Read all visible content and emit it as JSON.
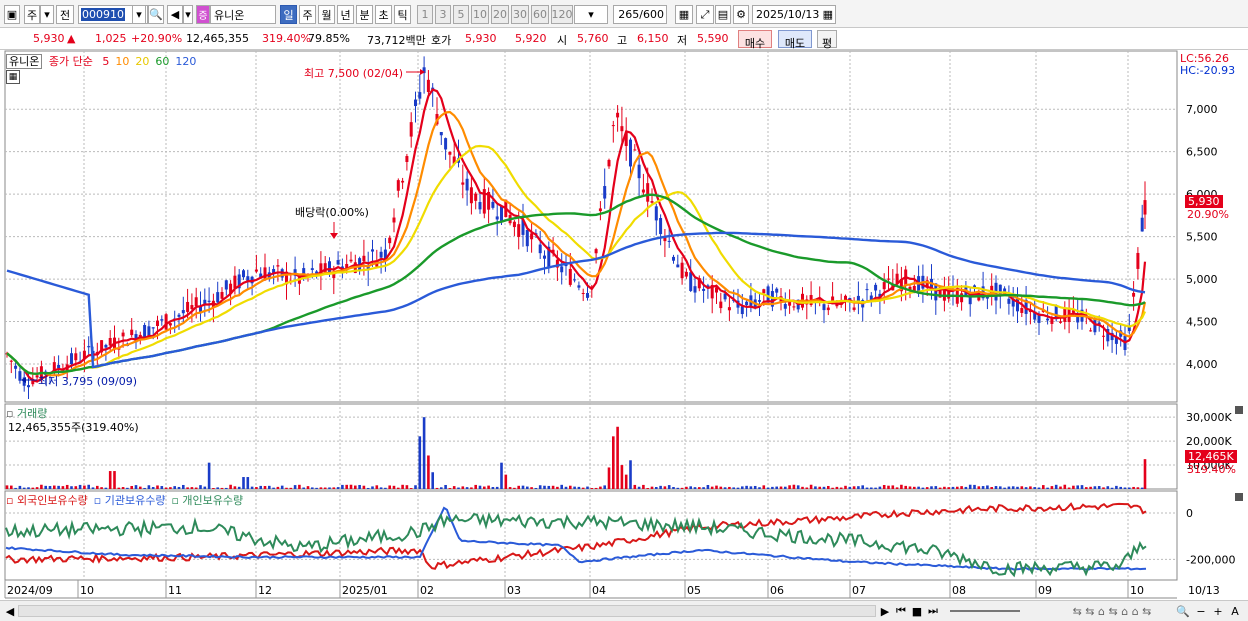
{
  "toolbar": {
    "mode_label": "주",
    "prev_label": "전",
    "stock_code": "000910",
    "stock_name": "유니온",
    "badge_text": "증",
    "periods": [
      "일",
      "주",
      "월",
      "년",
      "분",
      "초",
      "틱"
    ],
    "active_period": "일",
    "intervals": [
      "1",
      "3",
      "5",
      "10",
      "20",
      "30",
      "60",
      "120"
    ],
    "count_value": "265",
    "count_total": "/600",
    "date": "2025/10/13"
  },
  "quote": {
    "price": "5,930",
    "change": "1,025",
    "change_pct": "+20.90%",
    "volume": "12,465,355",
    "volume_pct": "319.40%",
    "turnover": "79.85%",
    "amount": "73,712백만",
    "bid_label": "호가",
    "ask": "5,930",
    "bid": "5,920",
    "open_label": "시",
    "open": "5,760",
    "high_label": "고",
    "high": "6,150",
    "low_label": "저",
    "low": "5,590",
    "buy_label": "매수",
    "sell_label": "매도",
    "eval_label": "평"
  },
  "price_panel": {
    "legend_name": "유니온",
    "legend_type": "종가 단순",
    "ma": [
      {
        "period": "5",
        "color": "#e4001b"
      },
      {
        "period": "10",
        "color": "#ff8c00"
      },
      {
        "period": "20",
        "color": "#e8c800"
      },
      {
        "period": "60",
        "color": "#1a9a2a"
      },
      {
        "period": "120",
        "color": "#2a5ad8"
      }
    ],
    "lc": "LC:56.26",
    "hc": "HC:-20.93",
    "high_annotation": "최고 7,500 (02/04)",
    "low_annotation": "최저 3,795 (09/09)",
    "dividend_annotation": "배당락(0.00%)",
    "y_ticks": [
      "7,000",
      "6,500",
      "6,000",
      "5,500",
      "5,000",
      "4,500",
      "4,000"
    ],
    "last_price_badge": "5,930",
    "last_pct_badge": "20.90%"
  },
  "volume_panel": {
    "title": "거래량",
    "value_text": "12,465,355주(319.40%)",
    "y_ticks": [
      "30,000K",
      "20,000K",
      "10,000K"
    ],
    "last_badge": "12,465K",
    "last_pct": "319.40%"
  },
  "holding_panel": {
    "series": [
      "외국인보유수량",
      "기관보유수량",
      "개인보유수량"
    ],
    "series_colors": [
      "#d81818",
      "#2a5ad8",
      "#2e8a5a"
    ],
    "y_ticks": [
      "0",
      "-200,000"
    ]
  },
  "x_axis": {
    "labels": [
      "2024/09",
      "10",
      "11",
      "12",
      "2025/01",
      "02",
      "03",
      "04",
      "05",
      "06",
      "07",
      "08",
      "09",
      "10"
    ],
    "end_label": "10/13"
  },
  "chart_data": {
    "type": "candlestick",
    "x_range": [
      "2024/09",
      "2025/10/13"
    ],
    "y_range": [
      3795,
      7500
    ],
    "close_path": [
      [
        "2024/09",
        4150
      ],
      [
        "2024/09/09",
        3795
      ],
      [
        "10",
        4100
      ],
      [
        "10/15",
        4300
      ],
      [
        "11",
        4500
      ],
      [
        "11/15",
        4750
      ],
      [
        "12",
        5100
      ],
      [
        "12/15",
        5000
      ],
      [
        "2025/01",
        5150
      ],
      [
        "01/20",
        5300
      ],
      [
        "02/04",
        7500
      ],
      [
        "02/10",
        6600
      ],
      [
        "02/20",
        6000
      ],
      [
        "03",
        5800
      ],
      [
        "03/15",
        5300
      ],
      [
        "04",
        4850
      ],
      [
        "04/10",
        6900
      ],
      [
        "04/25",
        6100
      ],
      [
        "05",
        5000
      ],
      [
        "05/20",
        4650
      ],
      [
        "06",
        4800
      ],
      [
        "06/20",
        4700
      ],
      [
        "07",
        4700
      ],
      [
        "07/20",
        5000
      ],
      [
        "08",
        4800
      ],
      [
        "08/20",
        4850
      ],
      [
        "09",
        4600
      ],
      [
        "09/20",
        4550
      ],
      [
        "10",
        4250
      ],
      [
        "10/13",
        5930
      ]
    ]
  }
}
